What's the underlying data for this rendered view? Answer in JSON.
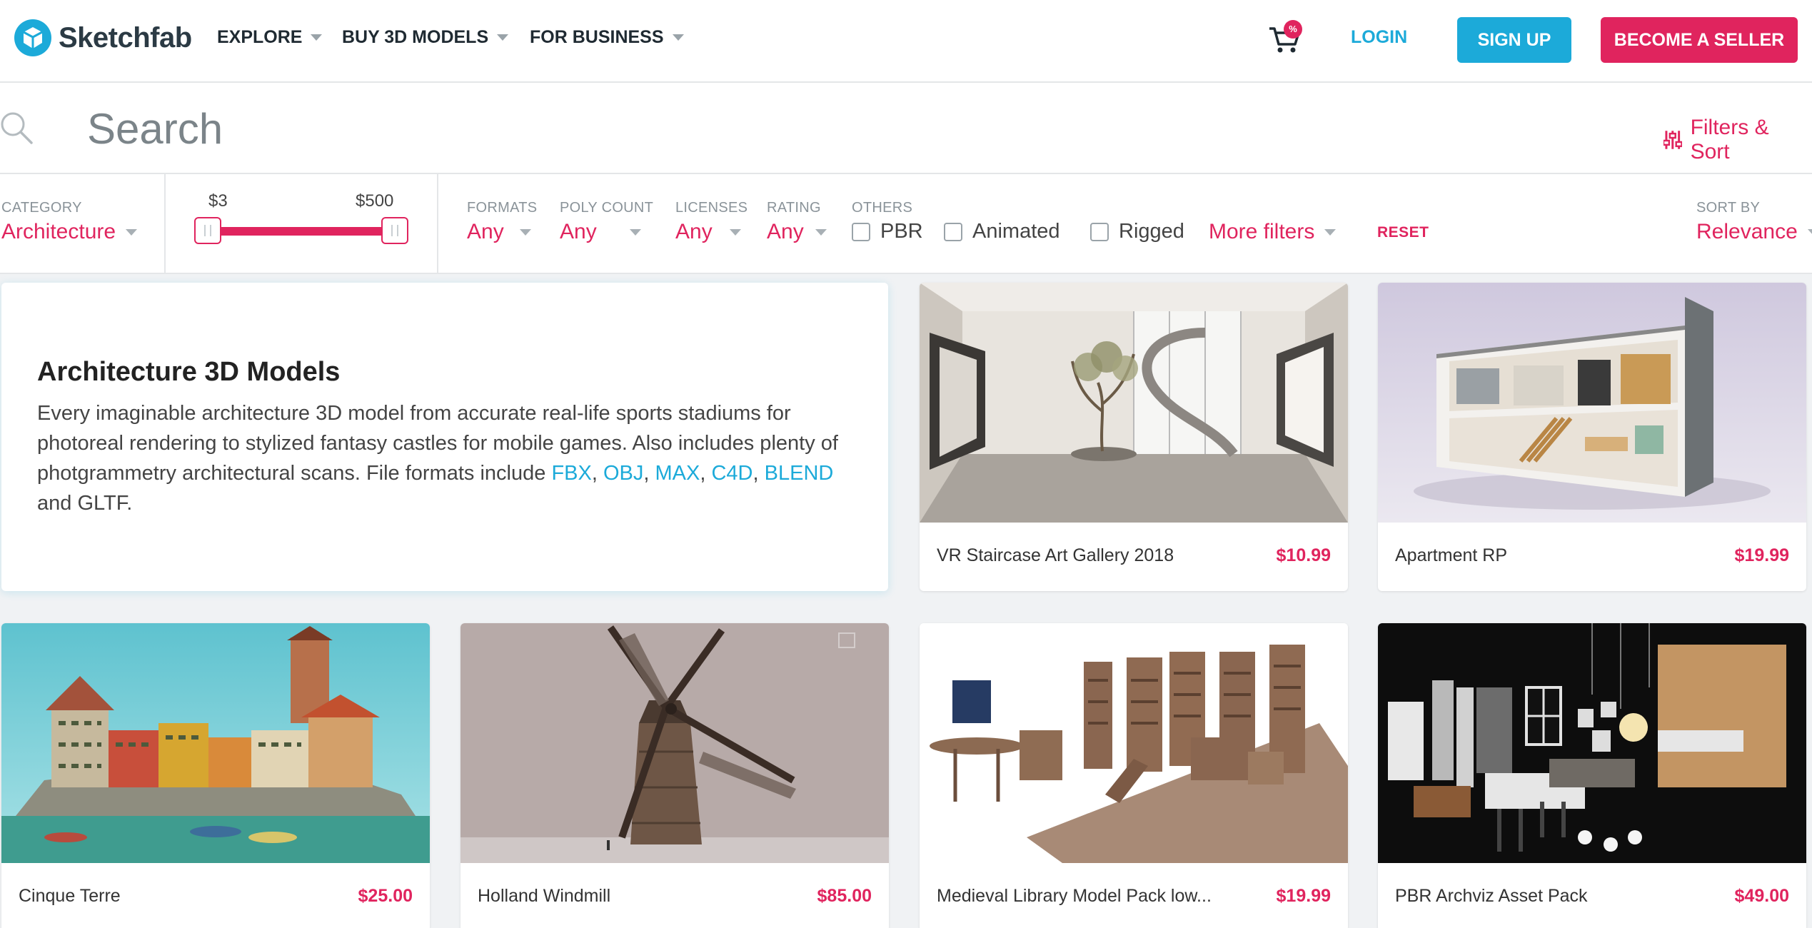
{
  "header": {
    "logo_text": "Sketchfab",
    "nav": [
      {
        "label": "EXPLORE"
      },
      {
        "label": "BUY 3D MODELS"
      },
      {
        "label": "FOR BUSINESS"
      }
    ],
    "cart_badge": "%",
    "login": "LOGIN",
    "signup": "SIGN UP",
    "seller": "BECOME A SELLER"
  },
  "search": {
    "placeholder": "Search",
    "filters_sort": "Filters & Sort"
  },
  "filters": {
    "category": {
      "label": "CATEGORY",
      "value": "Architecture"
    },
    "price": {
      "min": "$3",
      "max": "$500"
    },
    "formats": {
      "label": "FORMATS",
      "value": "Any"
    },
    "poly_count": {
      "label": "POLY COUNT",
      "value": "Any"
    },
    "licenses": {
      "label": "LICENSES",
      "value": "Any"
    },
    "rating": {
      "label": "RATING",
      "value": "Any"
    },
    "others": {
      "label": "OTHERS",
      "options": [
        "PBR",
        "Animated",
        "Rigged"
      ]
    },
    "more": "More filters",
    "reset": "RESET",
    "sort": {
      "label": "SORT BY",
      "value": "Relevance"
    }
  },
  "intro": {
    "title": "Architecture 3D Models",
    "text_1": "Every imaginable architecture 3D model from accurate real-life sports stadiums for photoreal rendering to stylized fantasy castles for mobile games. Also includes plenty of photgrammetry architectural scans. File formats include ",
    "formats": [
      "FBX",
      "OBJ",
      "MAX",
      "C4D",
      "BLEND"
    ],
    "text_2": " and GLTF."
  },
  "models": [
    {
      "name": "VR Staircase Art Gallery 2018",
      "price": "$10.99"
    },
    {
      "name": "Apartment RP",
      "price": "$19.99"
    },
    {
      "name": "Cinque Terre",
      "price": "$25.00"
    },
    {
      "name": "Holland Windmill",
      "price": "$85.00"
    },
    {
      "name": "Medieval Library Model Pack low...",
      "price": "$19.99"
    },
    {
      "name": "PBR Archviz Asset Pack",
      "price": "$49.00"
    }
  ],
  "colors": {
    "brand_blue": "#1caad9",
    "accent_pink": "#e0245e"
  }
}
